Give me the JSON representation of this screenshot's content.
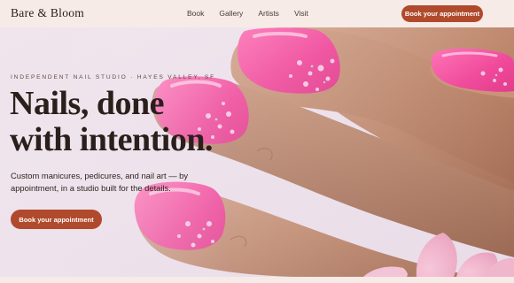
{
  "brand": {
    "name": "Bare & Bloom"
  },
  "nav": {
    "items": [
      {
        "label": "Book"
      },
      {
        "label": "Gallery"
      },
      {
        "label": "Artists"
      },
      {
        "label": "Visit"
      }
    ],
    "cta_label": "Book your appointment"
  },
  "hero": {
    "eyebrow": "INDEPENDENT NAIL STUDIO · HAYES VALLEY, SF",
    "headline_line1": "Nails, done",
    "headline_line2": "with intention.",
    "subhead": "Custom manicures, pedicures, and nail art — by appointment, in a studio built for the details.",
    "cta_label": "Book your appointment",
    "image_subject": "pink-glitter-manicure-photo"
  },
  "colors": {
    "accent": "#b04a2c",
    "header_bg": "#f6ebe6",
    "nail_pink": "#f0479a",
    "skin": "#c58e74"
  }
}
